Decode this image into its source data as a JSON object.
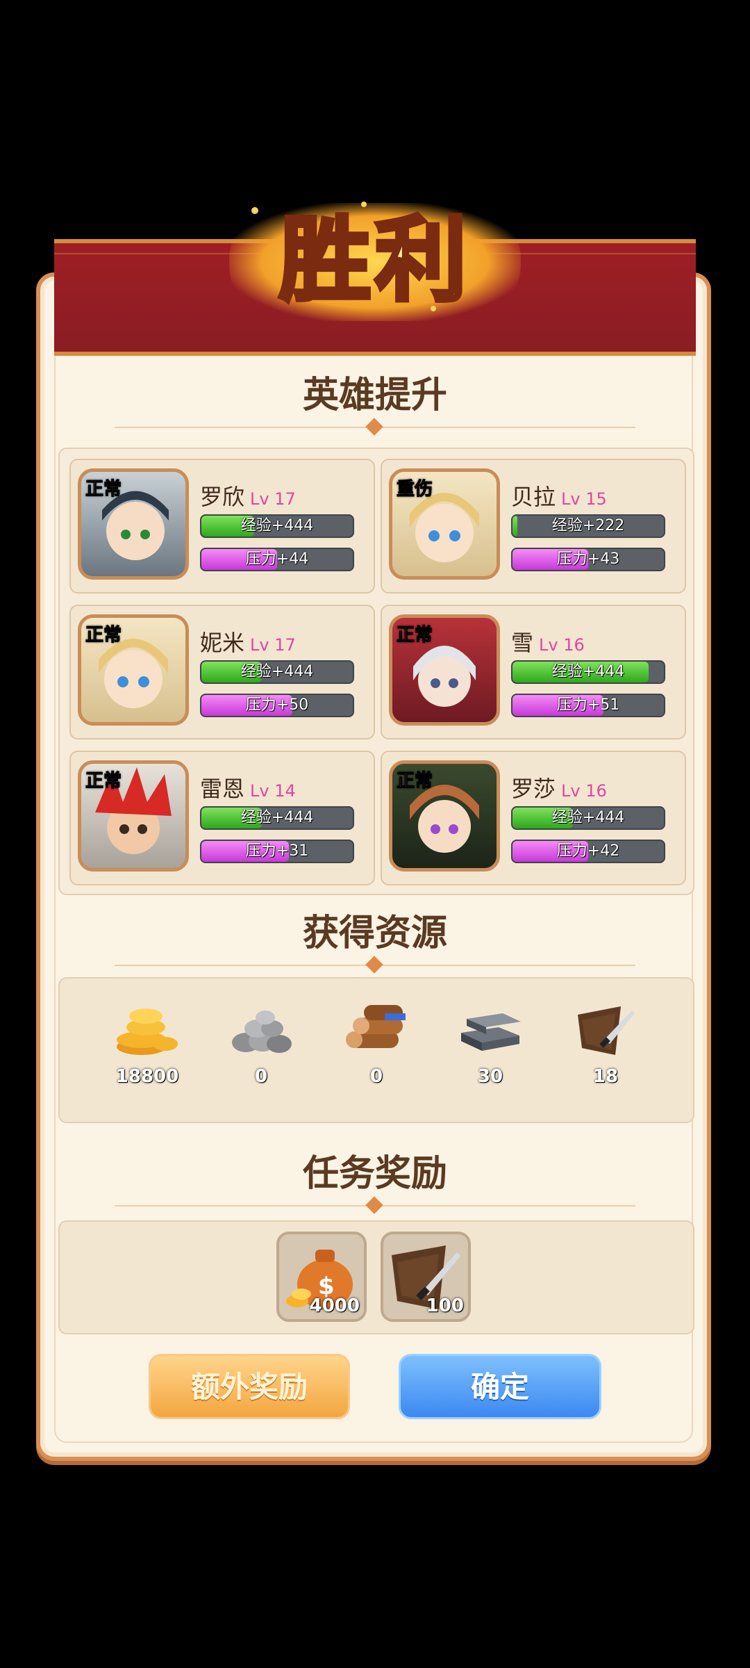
{
  "banner": {
    "title": "胜利"
  },
  "sections": {
    "heroes": "英雄提升",
    "resources": "获得资源",
    "rewards": "任务奖励"
  },
  "heroes": [
    {
      "name": "罗欣",
      "level": "Lv 17",
      "status": "正常",
      "exp": "经验+444",
      "exp_fill": 0.35,
      "stress": "压力+44",
      "stress_fill": 0.5
    },
    {
      "name": "贝拉",
      "level": "Lv 15",
      "status": "重伤",
      "exp": "经验+222",
      "exp_fill": 0.03,
      "stress": "压力+43",
      "stress_fill": 0.5
    },
    {
      "name": "妮米",
      "level": "Lv 17",
      "status": "正常",
      "exp": "经验+444",
      "exp_fill": 0.4,
      "stress": "压力+50",
      "stress_fill": 0.6
    },
    {
      "name": "雪",
      "level": "Lv 16",
      "status": "正常",
      "exp": "经验+444",
      "exp_fill": 0.9,
      "stress": "压力+51",
      "stress_fill": 0.6
    },
    {
      "name": "雷恩",
      "level": "Lv 14",
      "status": "正常",
      "exp": "经验+444",
      "exp_fill": 0.4,
      "stress": "压力+31",
      "stress_fill": 0.58
    },
    {
      "name": "罗莎",
      "level": "Lv 16",
      "status": "正常",
      "exp": "经验+444",
      "exp_fill": 0.4,
      "stress": "压力+42",
      "stress_fill": 0.5
    }
  ],
  "resources": [
    {
      "icon": "gold-coins-icon",
      "value": "18800"
    },
    {
      "icon": "stone-icon",
      "value": "0"
    },
    {
      "icon": "wood-icon",
      "value": "0"
    },
    {
      "icon": "iron-icon",
      "value": "30"
    },
    {
      "icon": "leather-icon",
      "value": "18"
    }
  ],
  "rewards": [
    {
      "icon": "money-bag-icon",
      "value": "4000"
    },
    {
      "icon": "leather-icon",
      "value": "100"
    }
  ],
  "buttons": {
    "extra": "额外奖励",
    "confirm": "确定"
  }
}
